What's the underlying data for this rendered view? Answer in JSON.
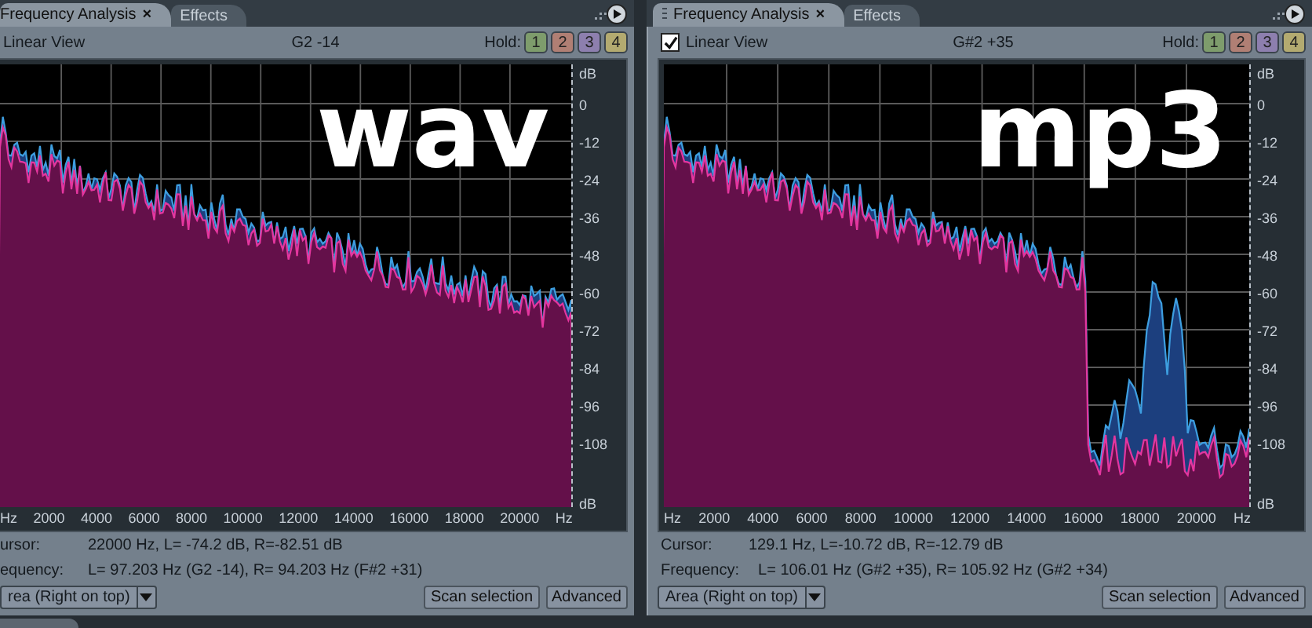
{
  "panels": [
    {
      "tabs": [
        {
          "label": "Frequency Analysis",
          "selected": true,
          "close": "×"
        },
        {
          "label": "Effects",
          "selected": false
        }
      ],
      "view_option": {
        "label": "Linear View"
      },
      "note": "G2 -14",
      "hold_label": "Hold:",
      "hold_buttons": [
        {
          "label": "1",
          "color": "#7e9c6c"
        },
        {
          "label": "2",
          "color": "#b07f74"
        },
        {
          "label": "3",
          "color": "#8d7fae"
        },
        {
          "label": "4",
          "color": "#b3aa70"
        }
      ],
      "y_ticks": [
        "dB",
        "0",
        "-12",
        "-24",
        "-36",
        "-48",
        "-60",
        "-72",
        "-84",
        "-96",
        "-108",
        "dB"
      ],
      "x_ticks": [
        "Hz",
        "2000",
        "4000",
        "6000",
        "8000",
        "10000",
        "12000",
        "14000",
        "16000",
        "18000",
        "20000",
        "Hz"
      ],
      "overlay": "wav",
      "cursor_label": "ursor:",
      "cursor_value": "22000 Hz, L= -74.2 dB, R=-82.51 dB",
      "frequency_label": "equency:",
      "frequency_value": "L= 97.203 Hz (G2 -14), R= 94.203 Hz (F#2 +31)",
      "display_select": "rea (Right on top)",
      "buttons": [
        "Scan selection",
        "Advanced"
      ]
    },
    {
      "tabs": [
        {
          "label": "Frequency Analysis",
          "selected": true,
          "close": "×"
        },
        {
          "label": "Effects",
          "selected": false
        }
      ],
      "view_option": {
        "label": "Linear View",
        "checked": true
      },
      "note": "G#2 +35",
      "hold_label": "Hold:",
      "hold_buttons": [
        {
          "label": "1",
          "color": "#7e9c6c"
        },
        {
          "label": "2",
          "color": "#b07f74"
        },
        {
          "label": "3",
          "color": "#8d7fae"
        },
        {
          "label": "4",
          "color": "#b3aa70"
        }
      ],
      "y_ticks": [
        "dB",
        "0",
        "-12",
        "-24",
        "-36",
        "-48",
        "-60",
        "-72",
        "-84",
        "-96",
        "-108",
        "dB"
      ],
      "x_ticks": [
        "Hz",
        "2000",
        "4000",
        "6000",
        "8000",
        "10000",
        "12000",
        "14000",
        "16000",
        "18000",
        "20000",
        "Hz"
      ],
      "overlay": "mp3",
      "cursor_label": "Cursor:",
      "cursor_value": "129.1 Hz, L=-10.72 dB, R=-12.79 dB",
      "frequency_label": "Frequency:",
      "frequency_value": "L= 106.01 Hz (G#2 +35), R= 105.92 Hz (G#2 +34)",
      "display_select": "Area (Right on top)",
      "buttons": [
        "Scan selection",
        "Advanced"
      ]
    }
  ]
}
